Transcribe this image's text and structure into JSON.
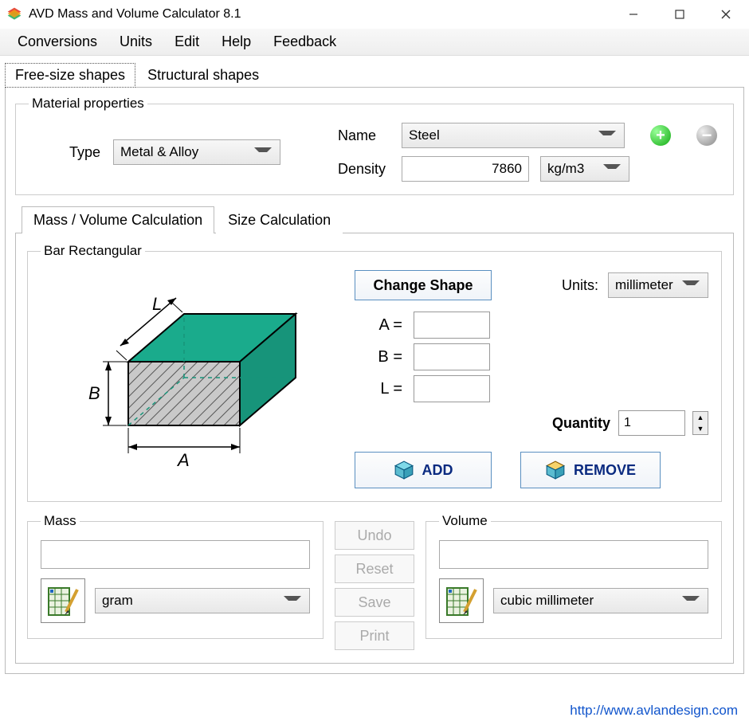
{
  "window": {
    "title": "AVD Mass and Volume Calculator 8.1"
  },
  "menu": {
    "items": [
      "Conversions",
      "Units",
      "Edit",
      "Help",
      "Feedback"
    ]
  },
  "mainTabs": {
    "active": "Free-size shapes",
    "inactive": "Structural shapes"
  },
  "material": {
    "legend": "Material properties",
    "typeLabel": "Type",
    "typeValue": "Metal & Alloy",
    "nameLabel": "Name",
    "nameValue": "Steel",
    "densityLabel": "Density",
    "densityValue": "7860",
    "densityUnit": "kg/m3"
  },
  "subTabs": {
    "active": "Mass / Volume  Calculation",
    "inactive": "Size  Calculation"
  },
  "shape": {
    "legend": "Bar Rectangular",
    "changeShape": "Change Shape",
    "unitsLabel": "Units:",
    "unitsValue": "millimeter",
    "dims": [
      {
        "label": "A  ="
      },
      {
        "label": "B  ="
      },
      {
        "label": "L  ="
      }
    ],
    "quantityLabel": "Quantity",
    "quantityValue": "1",
    "addLabel": "ADD",
    "removeLabel": "REMOVE"
  },
  "mass": {
    "legend": "Mass",
    "unit": "gram"
  },
  "volume": {
    "legend": "Volume",
    "unit": "cubic millimeter"
  },
  "midButtons": [
    "Undo",
    "Reset",
    "Save",
    "Print"
  ],
  "footerLink": "http://www.avlandesign.com"
}
